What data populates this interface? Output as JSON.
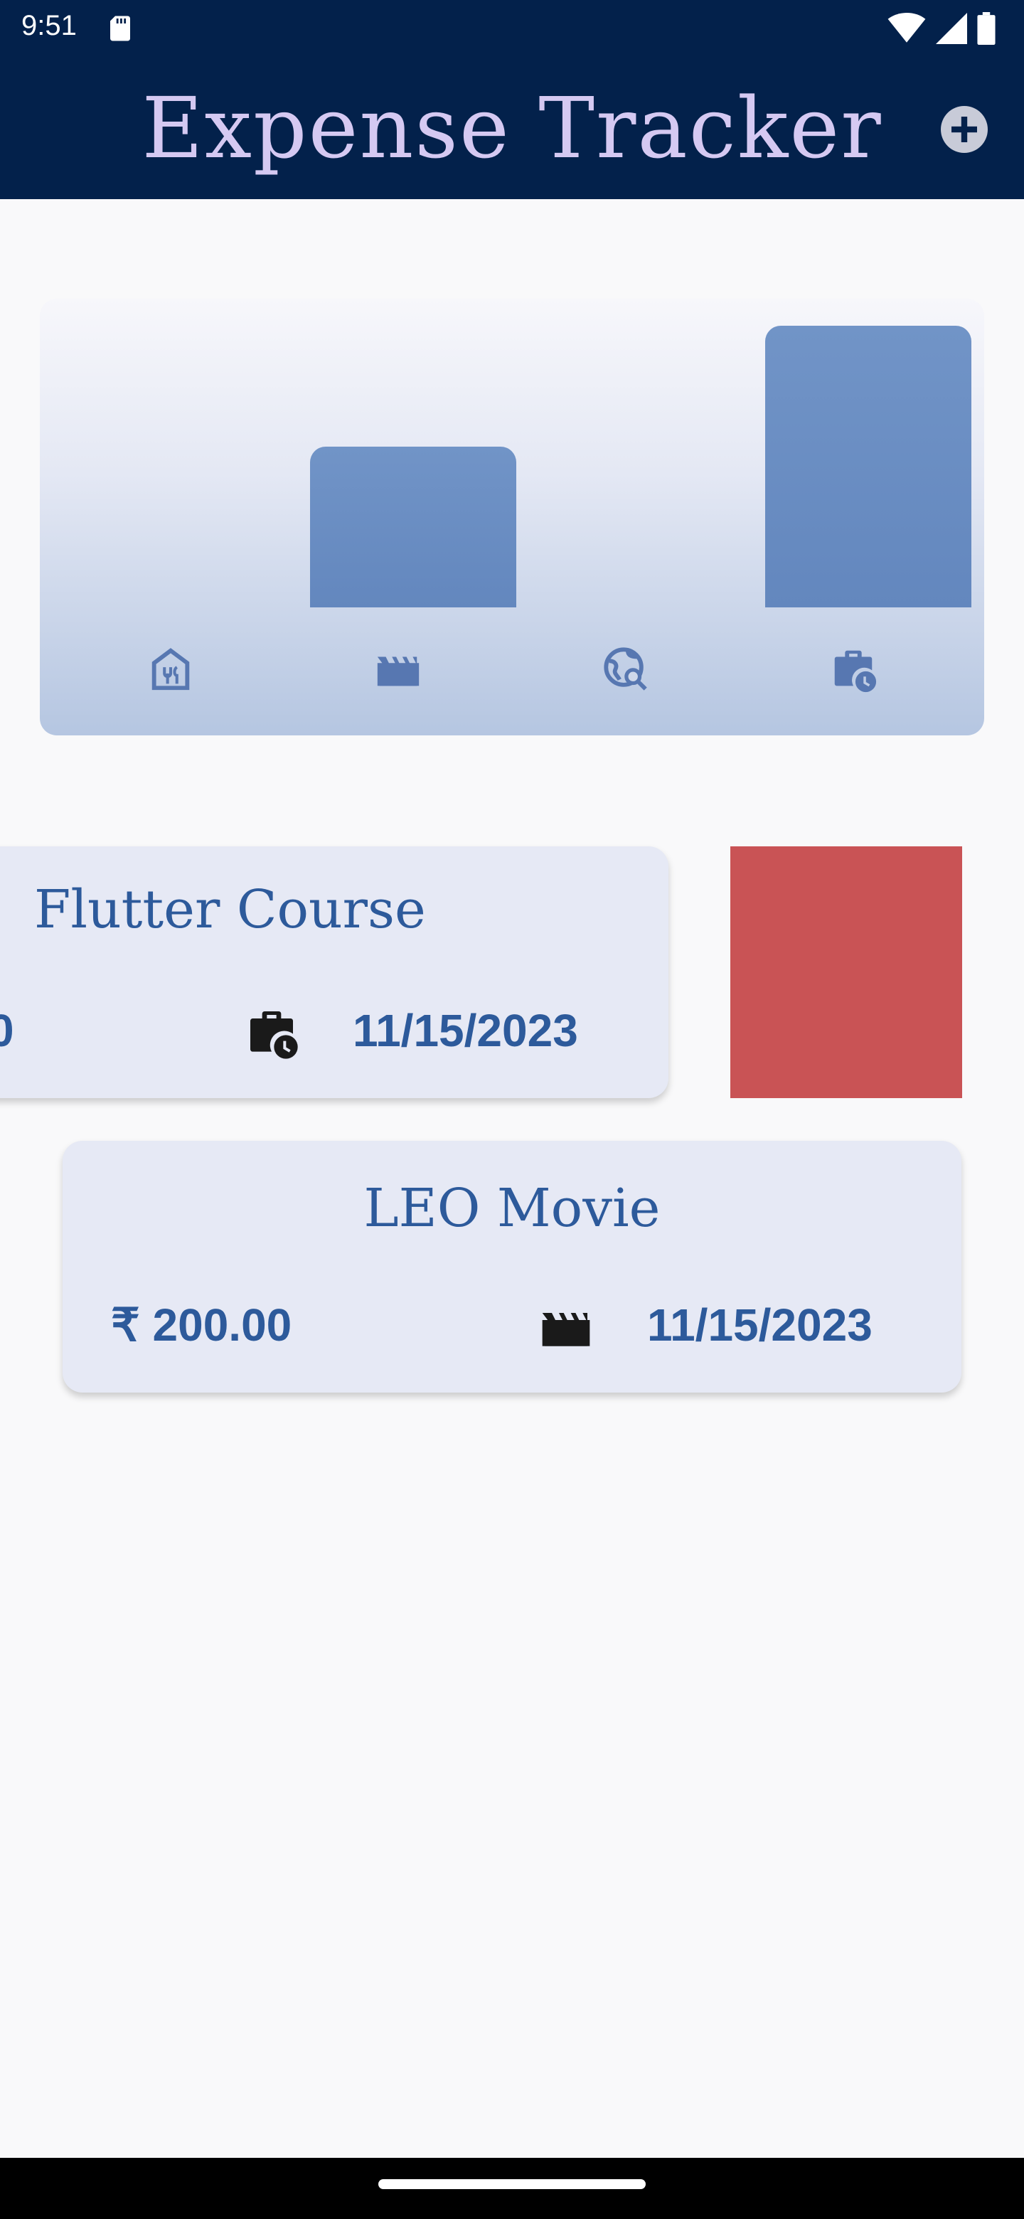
{
  "status_bar": {
    "time": "9:51"
  },
  "app_bar": {
    "title": "Expense Tracker",
    "add_icon": "add-circle-icon"
  },
  "colors": {
    "app_bar_bg": "#03214b",
    "title_color": "#d5c9f2",
    "bar_color": "#6a8fc4",
    "card_bg": "#e6e9f5",
    "accent_text": "#2d5a9b",
    "delete_bg": "#c95355"
  },
  "chart_data": {
    "type": "bar",
    "categories": [
      "food",
      "leisure",
      "travel",
      "work"
    ],
    "category_icons": [
      "restaurant-icon",
      "movie-icon",
      "travel-explore-icon",
      "work-history-icon"
    ],
    "values": [
      0,
      200,
      0,
      350
    ],
    "ylim": [
      0,
      350
    ],
    "note_units": "relative"
  },
  "expenses": [
    {
      "title": "Flutter Course",
      "amount": "0",
      "category_icon": "work-history-icon",
      "date": "11/15/2023",
      "state": "swiped-to-dismiss"
    },
    {
      "title": "LEO Movie",
      "amount": "₹ 200.00",
      "category_icon": "movie-icon",
      "date": "11/15/2023",
      "state": "normal"
    }
  ]
}
